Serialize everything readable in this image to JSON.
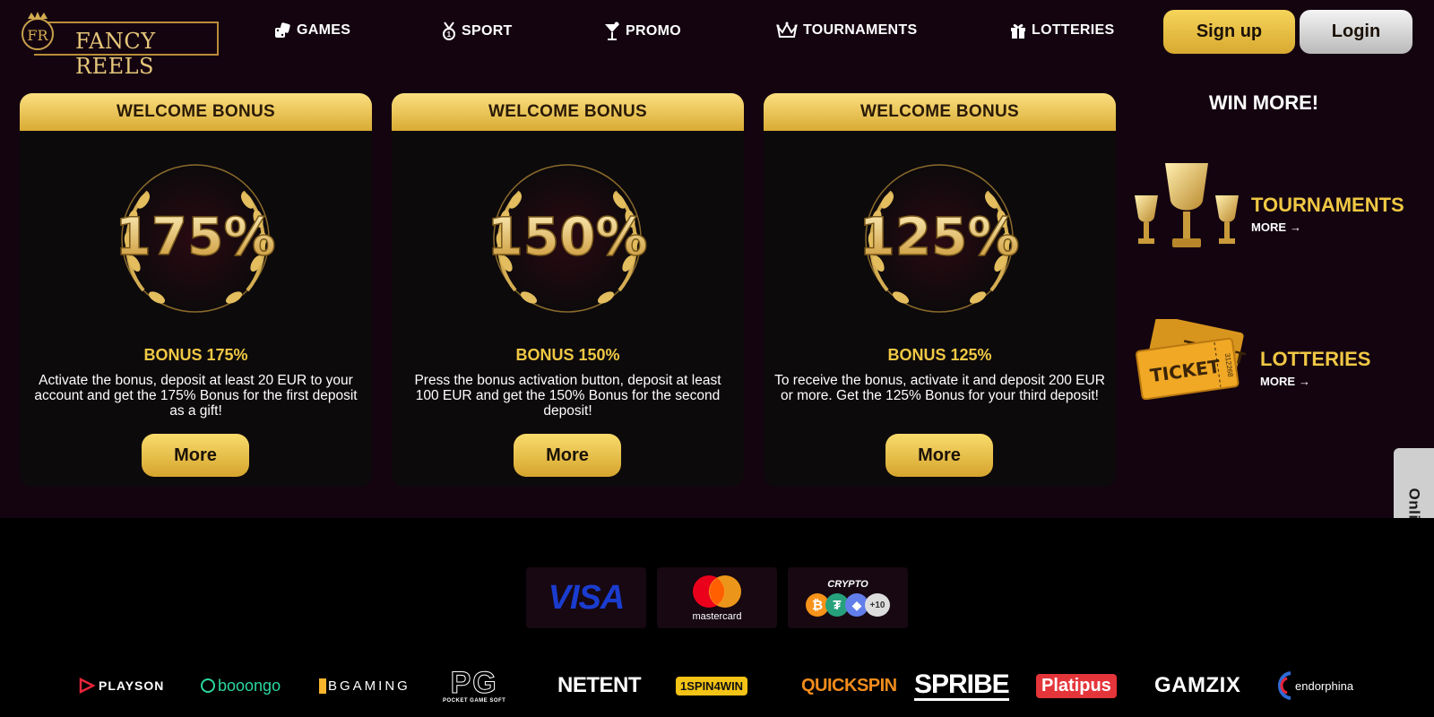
{
  "brand": {
    "name": "FANCY REELS",
    "monogram": "FR"
  },
  "nav": [
    {
      "label": "GAMES",
      "icon": "dice-icon"
    },
    {
      "label": "SPORT",
      "icon": "medal-icon"
    },
    {
      "label": "PROMO",
      "icon": "cocktail-icon"
    },
    {
      "label": "TOURNAMENTS",
      "icon": "crown-icon"
    },
    {
      "label": "LOTTERIES",
      "icon": "gift-icon"
    }
  ],
  "auth": {
    "signup": "Sign up",
    "login": "Login"
  },
  "cards": [
    {
      "header": "WELCOME BONUS",
      "badge": "175%",
      "title": "BONUS 175%",
      "desc": "Activate the bonus, deposit at least 20 EUR to your account and get the 175% Bonus for the first deposit as a gift!",
      "button": "More"
    },
    {
      "header": "WELCOME BONUS",
      "badge": "150%",
      "title": "BONUS 150%",
      "desc": "Press the bonus activation button, deposit at least 100 EUR and get the 150% Bonus for the second deposit!",
      "button": "More"
    },
    {
      "header": "WELCOME BONUS",
      "badge": "125%",
      "title": "BONUS 125%",
      "desc": "To receive the bonus, activate it and deposit 200 EUR or more. Get the 125% Bonus for your third deposit!",
      "button": "More"
    }
  ],
  "win_more": {
    "title": "WIN MORE!",
    "items": [
      {
        "title": "TOURNAMENTS",
        "more": "MORE",
        "icon": "trophy-icon"
      },
      {
        "title": "LOTTERIES",
        "more": "MORE",
        "icon": "ticket-icon"
      }
    ]
  },
  "chat": {
    "label": "Online Chat"
  },
  "payments": {
    "visa": "VISA",
    "mastercard": "mastercard",
    "crypto": {
      "label": "CRYPTO",
      "extra": "+10"
    }
  },
  "providers": [
    "PLAYSON",
    "booongo",
    "BGAMING",
    "PG",
    "NETENT",
    "1SPIN4WIN",
    "QUICKSPIN",
    "SPRIBE",
    "Platipus",
    "GAMZIX",
    "endorphina"
  ],
  "pg_sub": "POCKET GAME SOFT",
  "ticket_text": "TICKET",
  "ticket_number": "312268",
  "colors": {
    "gold": "#f0c844",
    "bg": "#140410",
    "footer": "#000000"
  }
}
